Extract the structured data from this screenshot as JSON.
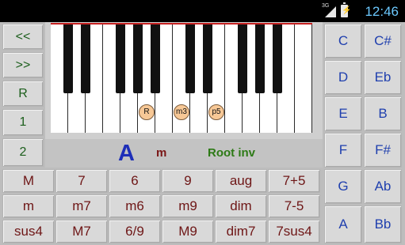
{
  "status": {
    "network": "3G",
    "time": "12:46"
  },
  "left_controls": [
    "<<",
    ">>",
    "R",
    "1",
    "2"
  ],
  "chord_display": {
    "root": "A",
    "quality": "m",
    "inversion": "Root inv"
  },
  "keyboard": {
    "white_key_count": 15,
    "black_key_after_white": [
      0,
      1,
      3,
      4,
      5,
      7,
      8,
      10,
      11,
      12
    ],
    "markers": [
      {
        "label": "R",
        "white_index": 5
      },
      {
        "label": "m3",
        "white_index": 7
      },
      {
        "label": "p5",
        "white_index": 9
      }
    ]
  },
  "chord_types": [
    [
      "M",
      "7",
      "6",
      "9",
      "aug",
      "7+5"
    ],
    [
      "m",
      "m7",
      "m6",
      "m9",
      "dim",
      "7-5"
    ],
    [
      "sus4",
      "M7",
      "6/9",
      "M9",
      "dim7",
      "7sus4"
    ]
  ],
  "notes": [
    [
      "C",
      "C#"
    ],
    [
      "D",
      "Eb"
    ],
    [
      "E",
      "B"
    ],
    [
      "F",
      "F#"
    ],
    [
      "G",
      "Ab"
    ],
    [
      "A",
      "Bb"
    ]
  ]
}
